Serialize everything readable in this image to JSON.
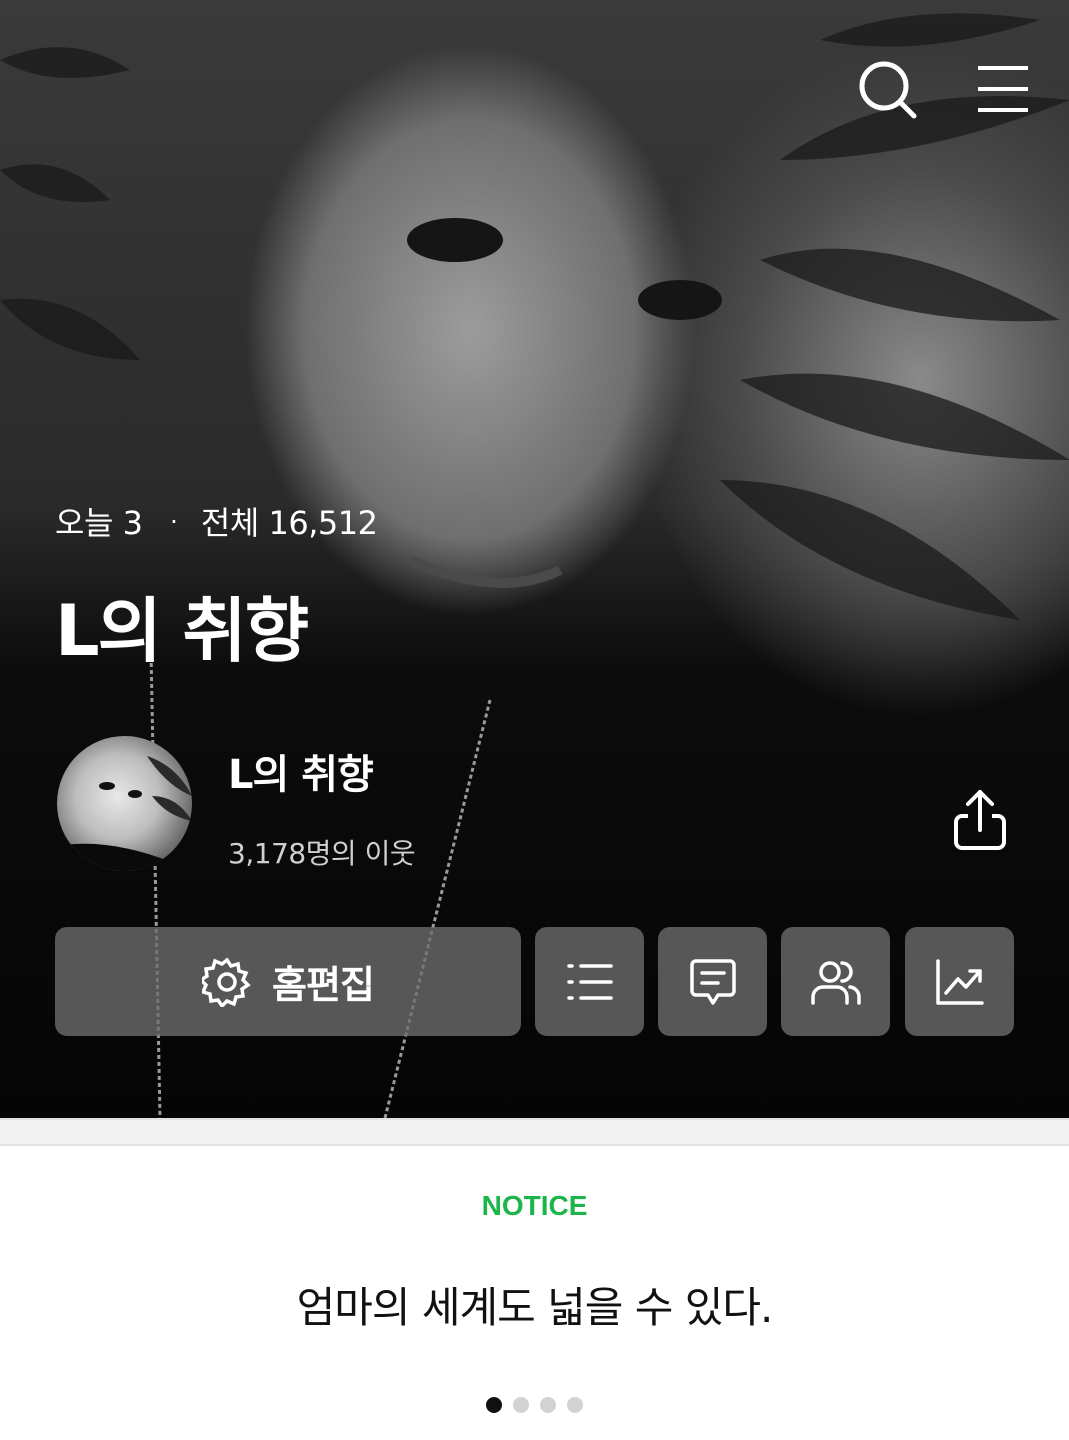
{
  "hero": {
    "icons": {
      "search": "search-icon",
      "menu": "hamburger-menu-icon",
      "share": "share-icon"
    },
    "stats": {
      "today_label": "오늘",
      "today_count": "3",
      "separator": "·",
      "total_label": "전체",
      "total_count": "16,512"
    },
    "blog_title": "L의 취향",
    "profile": {
      "name": "L의 취향",
      "neighbors": "3,178명의 이웃"
    },
    "actions": {
      "edit_home_label": "홈편집",
      "buttons": [
        "gear-icon",
        "list-icon",
        "comment-icon",
        "people-icon",
        "stats-chart-icon"
      ]
    }
  },
  "notice": {
    "label": "NOTICE",
    "text": "엄마의 세계도 넓을 수 있다.",
    "pagination": {
      "total": 4,
      "active": 1
    }
  },
  "colors": {
    "notice_accent": "#1bb54a",
    "button_bg": "#6e6e6e"
  }
}
